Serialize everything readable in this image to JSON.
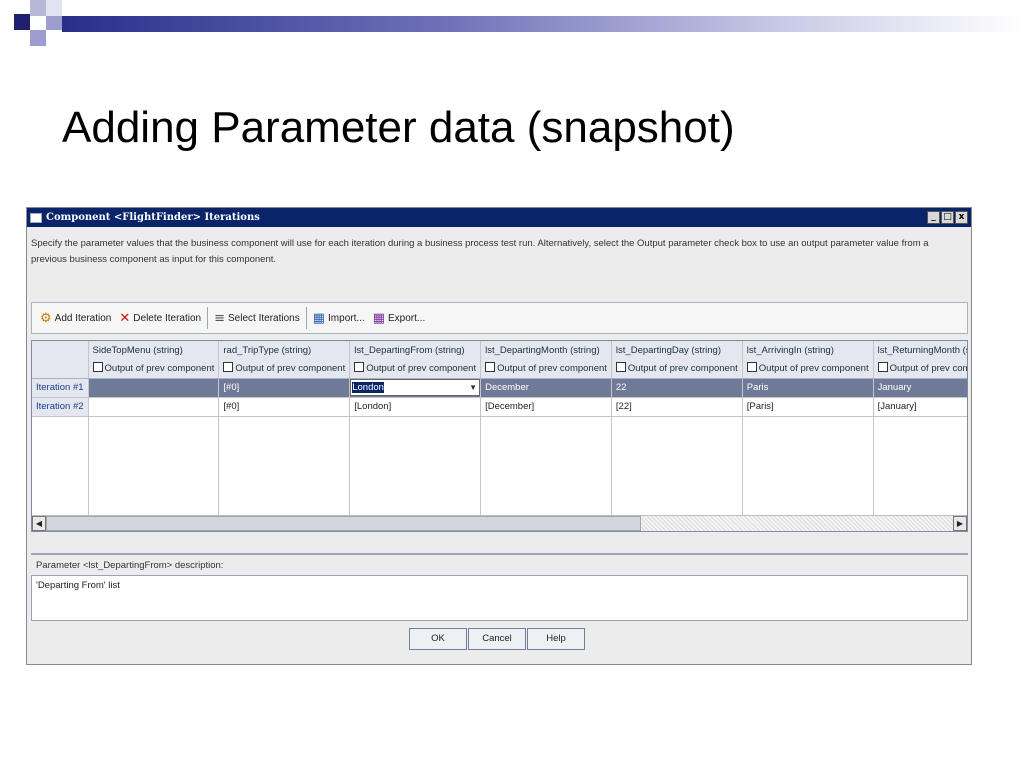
{
  "slide": {
    "title": "Adding Parameter data (snapshot)"
  },
  "window": {
    "title": "Component <FlightFinder> Iterations",
    "controls": {
      "minimize": "_",
      "maximize": "□",
      "close": "x"
    },
    "description": "Specify the parameter values that the business component will use for each iteration during a business process test run. Alternatively, select the Output parameter check box to use an output parameter value from a previous business component as input for this component."
  },
  "toolbar": {
    "add_iteration": "Add Iteration",
    "delete_iteration": "Delete Iteration",
    "select_iterations": "Select Iterations",
    "import": "Import...",
    "export": "Export..."
  },
  "grid": {
    "columns": [
      "SideTopMenu (string)",
      "rad_TripType (string)",
      "lst_DepartingFrom (string)",
      "lst_DepartingMonth (string)",
      "lst_DepartingDay (string)",
      "lst_ArrivingIn (string)",
      "lst_ReturningMonth (string)"
    ],
    "output_label": "Output of prev component",
    "rows": [
      {
        "label": "Iteration #1",
        "cells": [
          "",
          "[#0]",
          "London",
          "December",
          "22",
          "Paris",
          "January"
        ]
      },
      {
        "label": "Iteration #2",
        "cells": [
          "",
          "[#0]",
          "[London]",
          "[December]",
          "[22]",
          "[Paris]",
          "[January]"
        ]
      }
    ]
  },
  "parameter": {
    "label": "Parameter <lst_DepartingFrom> description:",
    "description": "'Departing From' list"
  },
  "buttons": {
    "ok": "OK",
    "cancel": "Cancel",
    "help": "Help"
  }
}
